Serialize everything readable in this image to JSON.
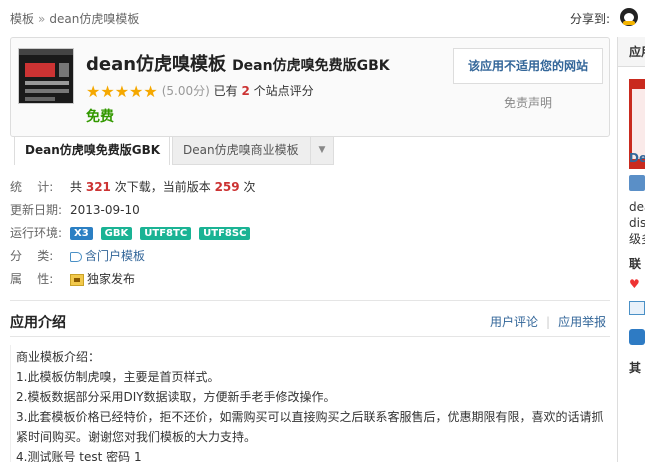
{
  "breadcrumb": {
    "root": "模板",
    "sep": "»",
    "current": "dean仿虎嗅模板"
  },
  "share": {
    "label": "分享到:",
    "icon": "qq-icon"
  },
  "app": {
    "name": "dean仿虎嗅模板",
    "subtitle": "Dean仿虎嗅免费版GBK",
    "stars": "★★★★★",
    "score": "(5.00分)",
    "rating_prefix": "已有",
    "rating_count": "2",
    "rating_suffix": "个站点评分",
    "price": "免费",
    "not_fit_button": "该应用不适用您的网站",
    "disclaimer_link": "免责声明"
  },
  "tabs": {
    "items": [
      {
        "label": "Dean仿虎嗅免费版GBK",
        "active": true
      },
      {
        "label": "Dean仿虎嗅商业模板",
        "active": false
      }
    ],
    "more_icon": "▼"
  },
  "stats": {
    "label": "统    计:",
    "prefix": "共",
    "downloads": "321",
    "middle": "次下载，当前版本",
    "version_downloads": "259",
    "suffix": "次"
  },
  "updated": {
    "label": "更新日期:",
    "value": "2013-09-10"
  },
  "env": {
    "label": "运行环境:",
    "badges": [
      "X3",
      "GBK",
      "UTF8TC",
      "UTF8SC"
    ]
  },
  "category": {
    "label": "分    类:",
    "value": "含门户模板"
  },
  "attribute": {
    "label": "属    性:",
    "value": "独家发布"
  },
  "intro": {
    "title": "应用介绍",
    "user_comments": "用户评论",
    "report": "应用举报",
    "lines": [
      "商业模板介绍：",
      "1.此模板仿制虎嗅，主要是首页样式。",
      "2.模板数据部分采用DIY数据读取，方便新手老手修改操作。",
      "3.此套模板价格已经特价，拒不还价，如需购买可以直接购买之后联系客服售后，优惠期限有限，喜欢的话请抓紧时间购买。谢谢您对我们模板的大力支持。",
      "4.测试账号 test 密码 1"
    ]
  },
  "sidebar": {
    "header": "应用",
    "author_link": "De",
    "author_text_1": "dea",
    "author_text_2": "disc",
    "author_text_3": "级多",
    "section_contact": "联",
    "section_other": "其"
  },
  "colors": {
    "accent": "#336699",
    "price": "#339900",
    "count": "#cc3333",
    "badge": "#1ab394",
    "star": "#f5a800"
  }
}
